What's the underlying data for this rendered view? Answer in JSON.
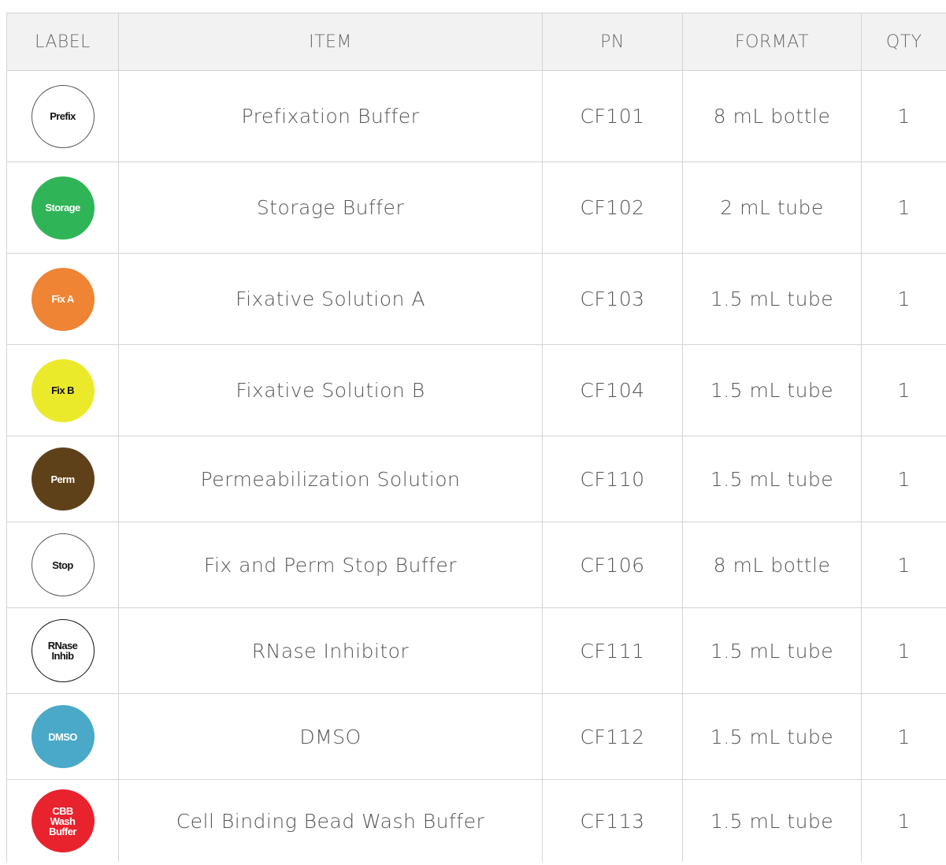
{
  "table": {
    "headers": [
      "LABEL",
      "ITEM",
      "PN",
      "FORMAT",
      "QTY"
    ],
    "rows": [
      {
        "label": "Prefix",
        "label_bg": "#ffffff",
        "label_fg": "#111111",
        "label_border": "#555555",
        "item": "Prefixation  Buffer",
        "pn": "CF101",
        "format": "8 mL bottle",
        "qty": "1"
      },
      {
        "label": "Storage",
        "label_bg": "#2fb457",
        "label_fg": "#ffffff",
        "item": "Storage  Buffer",
        "pn": "CF102",
        "format": "2 mL tube",
        "qty": "1"
      },
      {
        "label": "Fix A",
        "label_bg": "#ee8434",
        "label_fg": "#ffffff",
        "item": "Fixative  Solution  A",
        "pn": "CF103",
        "format": "1.5 mL tube",
        "qty": "1"
      },
      {
        "label": "Fix B",
        "label_bg": "#ebea2a",
        "label_fg": "#111111",
        "item": "Fixative  Solution  B",
        "pn": "CF104",
        "format": "1.5 mL tube",
        "qty": "1"
      },
      {
        "label": "Perm",
        "label_bg": "#5f4119",
        "label_fg": "#ffffff",
        "item": "Permeabilization  Solution",
        "pn": "CF110",
        "format": "1.5 mL tube",
        "qty": "1"
      },
      {
        "label": "Stop",
        "label_bg": "#ffffff",
        "label_fg": "#111111",
        "label_border": "#555555",
        "item": "Fix and Perm Stop Buffer",
        "pn": "CF106",
        "format": "8 mL bottle",
        "qty": "1"
      },
      {
        "label": "RNase\nInhib",
        "label_bg": "#ffffff",
        "label_fg": "#111111",
        "label_border": "#111111",
        "item": "RNase Inhibitor",
        "pn": "CF111",
        "format": "1.5 mL tube",
        "qty": "1"
      },
      {
        "label": "DMSO",
        "label_bg": "#4aa9c8",
        "label_fg": "#ffffff",
        "item": "DMSO",
        "pn": "CF112",
        "format": "1.5 mL tube",
        "qty": "1"
      },
      {
        "label": "CBB\nWash\nBuffer",
        "label_bg": "#e8232e",
        "label_fg": "#ffffff",
        "item": "Cell Binding Bead Wash Buffer",
        "pn": "CF113",
        "format": "1.5 mL tube",
        "qty": "1"
      }
    ]
  }
}
